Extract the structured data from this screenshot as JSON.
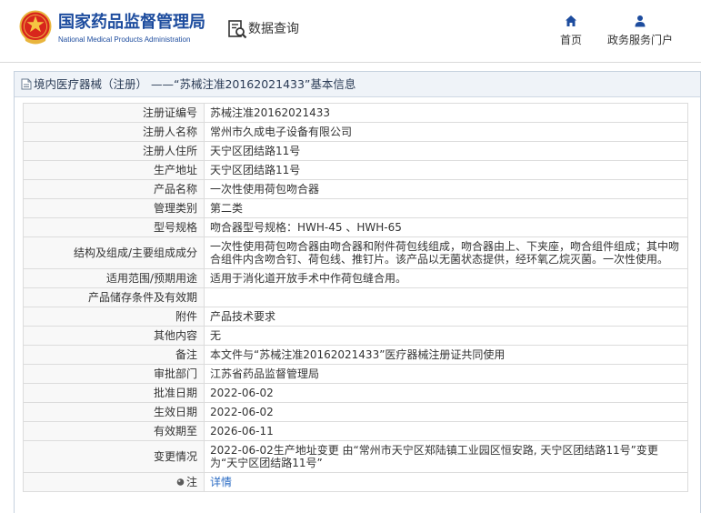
{
  "header": {
    "logo_icon": "nmpa-emblem-logo",
    "org_name_cn": "国家药品监督管理局",
    "org_name_en": "National Medical Products Administration",
    "data_query": {
      "label": "数据查询",
      "icon": "search-document-icon"
    },
    "nav": [
      {
        "label": "首页",
        "icon": "home-icon"
      },
      {
        "label": "政务服务门户",
        "icon": "user-icon"
      }
    ]
  },
  "panel": {
    "title_icon": "document-icon",
    "title": "境内医疗器械（注册） ——“苏械注准20162021433”基本信息"
  },
  "details": [
    {
      "label": "注册证编号",
      "value": "苏械注准20162021433"
    },
    {
      "label": "注册人名称",
      "value": "常州市久成电子设备有限公司"
    },
    {
      "label": "注册人住所",
      "value": "天宁区团结路11号"
    },
    {
      "label": "生产地址",
      "value": "天宁区团结路11号"
    },
    {
      "label": "产品名称",
      "value": "一次性使用荷包吻合器"
    },
    {
      "label": "管理类别",
      "value": "第二类"
    },
    {
      "label": "型号规格",
      "value": "吻合器型号规格：HWH-45 、HWH-65"
    },
    {
      "label": "结构及组成/主要组成成分",
      "value": "一次性使用荷包吻合器由吻合器和附件荷包线组成，吻合器由上、下夹座，吻合组件组成；其中吻合组件内含吻合钉、荷包线、推钉片。该产品以无菌状态提供，经环氧乙烷灭菌。一次性使用。"
    },
    {
      "label": "适用范围/预期用途",
      "value": "适用于消化道开放手术中作荷包缝合用。"
    },
    {
      "label": "产品储存条件及有效期",
      "value": ""
    },
    {
      "label": "附件",
      "value": "产品技术要求"
    },
    {
      "label": "其他内容",
      "value": "无"
    },
    {
      "label": "备注",
      "value": "本文件与“苏械注准20162021433”医疗器械注册证共同使用"
    },
    {
      "label": "审批部门",
      "value": "江苏省药品监督管理局"
    },
    {
      "label": "批准日期",
      "value": "2022-06-02"
    },
    {
      "label": "生效日期",
      "value": "2022-06-02"
    },
    {
      "label": "有效期至",
      "value": "2026-06-11"
    },
    {
      "label": "变更情况",
      "value": "2022-06-02生产地址变更 由“常州市天宁区郑陆镇工业园区恒安路, 天宁区团结路11号”变更为“天宁区团结路11号”"
    },
    {
      "label": "注",
      "value": "详情",
      "icon": "note-icon"
    }
  ],
  "colors": {
    "brand_blue": "#1d4c9e",
    "link_blue": "#2a6bc4",
    "emblem_red": "#d8261c",
    "emblem_gold": "#e9b53d",
    "table_border": "#dcdcdc",
    "title_bar_bg": "#eff3f8"
  }
}
